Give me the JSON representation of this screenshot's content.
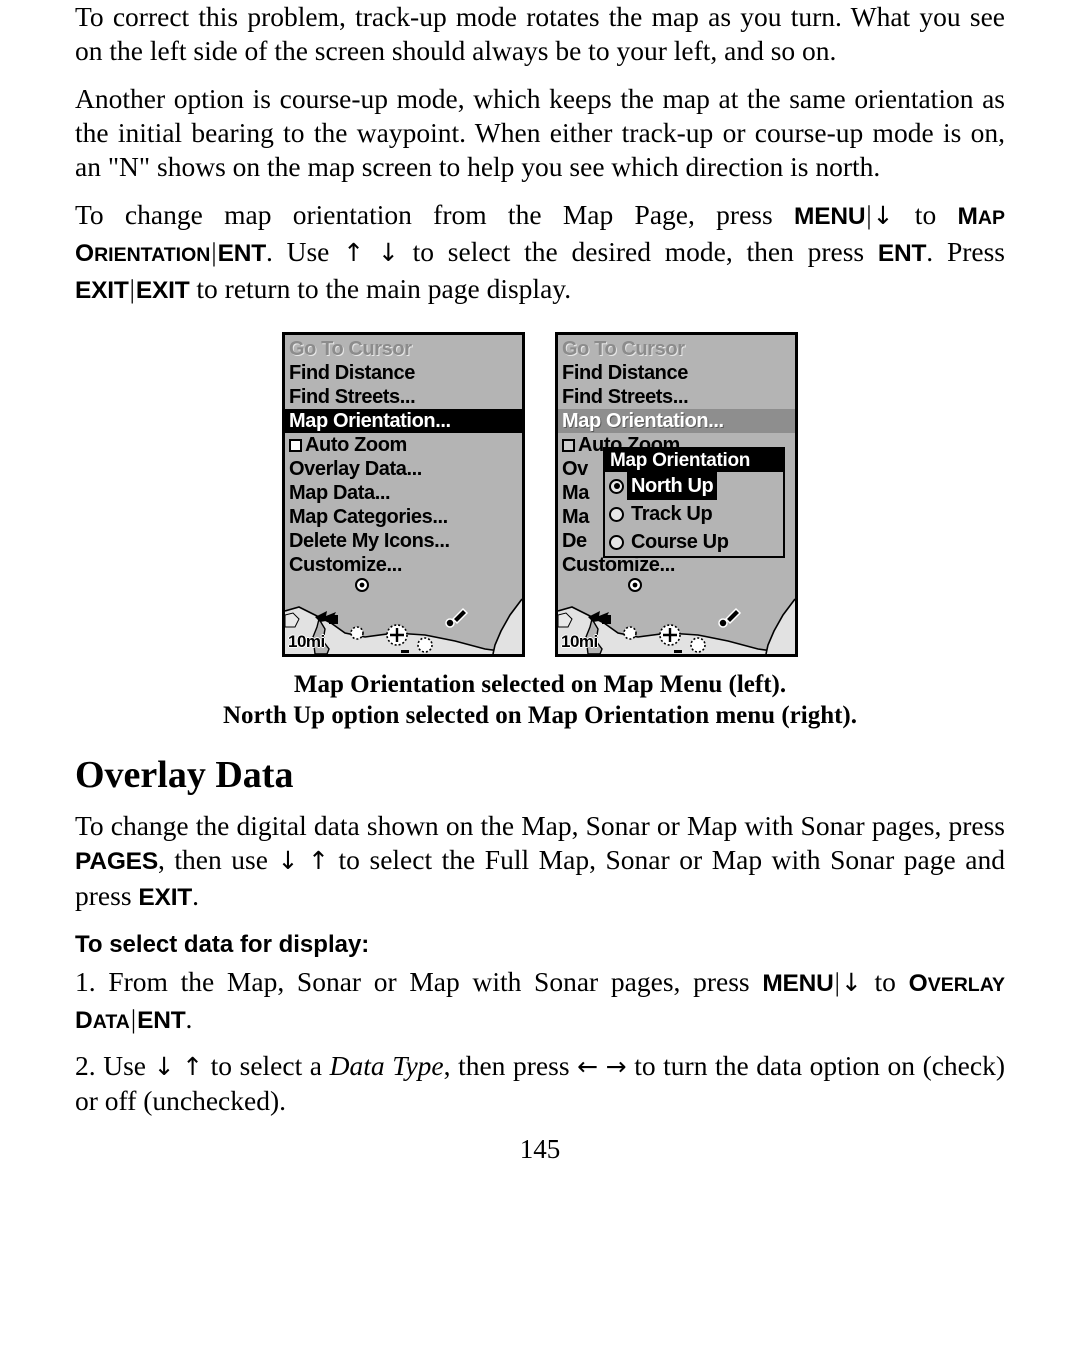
{
  "page": {
    "number": "145"
  },
  "paragraphs": {
    "p1": {
      "text": "To correct this problem, track-up mode rotates the map as you turn. What you see on the left side of the screen should always be to your left, and so on."
    },
    "p2": {
      "text": "Another option is course-up mode, which keeps the map at the same orientation as the initial bearing to the waypoint. When either track-up or course-up mode is on, an \"N\" shows on the map screen to help you see which direction is north."
    },
    "p3": {
      "seg1": "To change map orientation from the Map Page, press ",
      "key_menu": "MENU",
      "bar1": "|",
      "arrow_down1": "↓",
      "seg2": " to ",
      "sc_map_orientation": "MAP ORIENTATION",
      "bar2": "|",
      "key_ent1": "ENT",
      "seg3": ". Use ",
      "arrow_up1": "↑",
      "arrow_down2": "↓",
      "seg4": " to select the desired mode, then press ",
      "key_ent2": "ENT",
      "seg5": ". Press ",
      "key_exit1": "EXIT",
      "bar3": "|",
      "key_exit2": "EXIT",
      "seg6": " to return to the main page display."
    },
    "overlay_intro": {
      "seg1": "To change the digital data shown on the Map, Sonar or Map with Sonar pages, press ",
      "key_pages": "PAGES",
      "seg2": ", then use ",
      "arrow_down": "↓",
      "arrow_up": "↑",
      "seg3": " to select the Full Map, Sonar or Map with Sonar page and press ",
      "key_exit": "EXIT",
      "seg4": "."
    },
    "step1": {
      "num": "1.",
      "seg1": " From the Map, Sonar or Map with Sonar pages, press ",
      "key_menu": "MENU",
      "bar1": "|",
      "arrow_down": "↓",
      "seg2": " to ",
      "sc_overlay_data": "OVERLAY DATA",
      "bar2": "|",
      "key_ent": "ENT",
      "seg3": "."
    },
    "step2": {
      "num": "2.",
      "seg1": " Use ",
      "arrow_down": "↓",
      "arrow_up": "↑",
      "seg2": " to select a ",
      "italic_data_type": "Data Type",
      "seg3": ", then press ",
      "arrow_left": "←",
      "arrow_right": "→",
      "seg4": " to turn the data option on (check) or off (unchecked)."
    }
  },
  "headings": {
    "overlay_data": "Overlay Data",
    "to_select": "To select data for display:"
  },
  "figure": {
    "caption_line1": "Map Orientation selected on Map Menu (left).",
    "caption_line2": "North Up option selected on Map Orientation menu (right).",
    "left_screen": {
      "menu_items": [
        {
          "label": "Go To Cursor",
          "state": "disabled",
          "widget": "none"
        },
        {
          "label": "Find Distance",
          "state": "normal",
          "widget": "none"
        },
        {
          "label": "Find Streets...",
          "state": "normal",
          "widget": "none"
        },
        {
          "label": "Map Orientation...",
          "state": "selected-dark",
          "widget": "none"
        },
        {
          "label": "Auto Zoom",
          "state": "normal",
          "widget": "checkbox-unchecked"
        },
        {
          "label": "Overlay Data...",
          "state": "normal",
          "widget": "none"
        },
        {
          "label": "Map Data...",
          "state": "normal",
          "widget": "none"
        },
        {
          "label": "Map Categories...",
          "state": "normal",
          "widget": "none"
        },
        {
          "label": "Delete My Icons...",
          "state": "normal",
          "widget": "none"
        },
        {
          "label": "Customize...",
          "state": "normal",
          "widget": "none"
        }
      ],
      "map_scale": "10mi"
    },
    "right_screen": {
      "menu_items": [
        {
          "label": "Go To Cursor",
          "state": "disabled",
          "widget": "none"
        },
        {
          "label": "Find Distance",
          "state": "normal",
          "widget": "none"
        },
        {
          "label": "Find Streets...",
          "state": "normal",
          "widget": "none"
        },
        {
          "label": "Map Orientation...",
          "state": "selected-gray",
          "widget": "none"
        },
        {
          "label": "Auto Zoom",
          "state": "normal",
          "widget": "checkbox-shaded"
        },
        {
          "label": "Ov",
          "state": "normal",
          "widget": "none"
        },
        {
          "label": "Ma",
          "state": "normal",
          "widget": "none"
        },
        {
          "label": "Ma",
          "state": "normal",
          "widget": "none"
        },
        {
          "label": "De",
          "state": "normal",
          "widget": "none"
        },
        {
          "label": "Customize...",
          "state": "normal",
          "widget": "none"
        }
      ],
      "submenu": {
        "title": "Map Orientation",
        "options": [
          {
            "label": "North Up",
            "selected": true
          },
          {
            "label": "Track Up",
            "selected": false
          },
          {
            "label": "Course Up",
            "selected": false
          }
        ]
      },
      "map_scale": "10mi"
    }
  },
  "colors": {
    "lcd_background": "#b4b4b4",
    "lcd_border": "#000000",
    "highlight_dark": "#000000",
    "highlight_gray": "#8e8e8e",
    "disabled_text": "#8c8c8c",
    "page_background": "#ffffff",
    "text": "#000000"
  }
}
